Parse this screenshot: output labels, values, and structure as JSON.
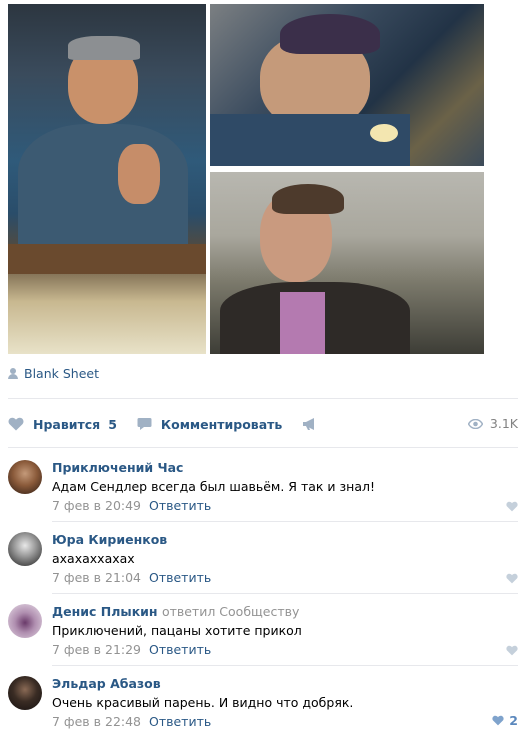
{
  "post": {
    "author_link": "Blank Sheet",
    "photos": [
      "photo-1",
      "photo-2",
      "photo-3"
    ]
  },
  "actions": {
    "like_label": "Нравится",
    "like_count": "5",
    "comment_label": "Комментировать",
    "views": "3.1K"
  },
  "comments": [
    {
      "name": "Приключений Час",
      "replied": "",
      "text": "Адам Сендлер всегда был шавьём. Я так и знал!",
      "time": "7 фев в 20:49",
      "reply_label": "Ответить",
      "likes": ""
    },
    {
      "name": "Юра Кириенков",
      "replied": "",
      "text": "ахахаххахах",
      "time": "7 фев в 21:04",
      "reply_label": "Ответить",
      "likes": ""
    },
    {
      "name": "Денис Плыкин",
      "replied": "ответил Сообществу",
      "text": "Приключений, пацаны хотите прикол",
      "time": "7 фев в 21:29",
      "reply_label": "Ответить",
      "likes": ""
    },
    {
      "name": "Эльдар Абазов",
      "replied": "",
      "text": "Очень красивый парень. И видно что добряк.",
      "time": "7 фев в 22:48",
      "reply_label": "Ответить",
      "likes": "2"
    }
  ],
  "colors": {
    "link": "#2a5885",
    "meta": "#939393",
    "divider": "#e7e8ec",
    "icon": "#a0b1c4"
  }
}
